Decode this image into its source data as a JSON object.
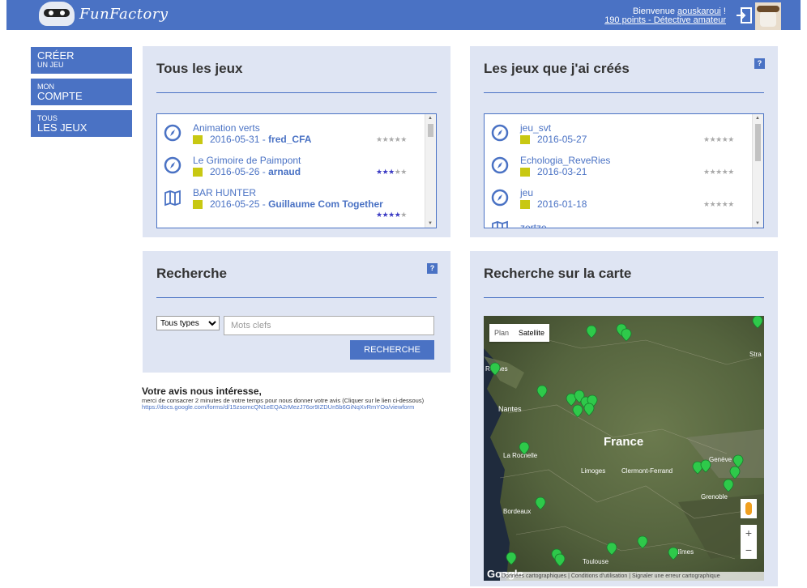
{
  "header": {
    "logo_text": "FunFactory",
    "welcome_prefix": "Bienvenue ",
    "username": "aouskaroui",
    "welcome_suffix": " !",
    "points": "190 points - Détective amateur"
  },
  "nav": [
    {
      "small": "Créer",
      "large": "un jeu"
    },
    {
      "small": "Mon",
      "large": "Compte"
    },
    {
      "small": "Tous",
      "large": "les jeux"
    }
  ],
  "all_games": {
    "title": "Tous les jeux",
    "items": [
      {
        "icon": "compass-icon",
        "title": "Animation verts",
        "date": "2016-05-31",
        "author": "fred_CFA",
        "rating": 0
      },
      {
        "icon": "compass-icon",
        "title": "Le Grimoire de Paimpont",
        "date": "2016-05-26",
        "author": "arnaud",
        "rating": 3
      },
      {
        "icon": "map-icon",
        "title": "BAR HUNTER",
        "date": "2016-05-25",
        "author": "Guillaume Com Together",
        "rating": 4
      }
    ]
  },
  "my_games": {
    "title": "Les jeux que j'ai créés",
    "help": "?",
    "items": [
      {
        "icon": "compass-icon",
        "title": "jeu_svt",
        "date": "2016-05-27",
        "rating": 0
      },
      {
        "icon": "compass-icon",
        "title": "Echologia_ReveRies",
        "date": "2016-03-21",
        "rating": 0
      },
      {
        "icon": "compass-icon",
        "title": "jeu",
        "date": "2016-01-18",
        "rating": 0
      },
      {
        "icon": "map-icon",
        "title": "zertze",
        "date": "",
        "rating": 0
      }
    ]
  },
  "search": {
    "title": "Recherche",
    "help": "?",
    "type_selected": "Tous types",
    "keywords_placeholder": "Mots clefs",
    "button": "RECHERCHE"
  },
  "feedback": {
    "heading": "Votre avis nous intéresse,",
    "text": "merci de consacrer 2 minutes de votre temps pour nous donner votre avis (Cliquer sur le lien ci-dessous)",
    "link": "https://docs.google.com/forms/d/15zsomcQN1eEQA2rMezJ76or9IZDUn5b6GiNqXvRmYOo/viewform"
  },
  "map_panel": {
    "title": "Recherche sur la carte",
    "toggle_plan": "Plan",
    "toggle_satellite": "Satellite",
    "zoom_in": "+",
    "zoom_out": "−",
    "google": "Google",
    "footer": "Données cartographiques | Conditions d'utilisation | Signaler une erreur cartographique",
    "labels": [
      "Rennes",
      "Nantes",
      "France",
      "La Rochelle",
      "Limoges",
      "Clermont-Ferrand",
      "Genève",
      "Grenoble",
      "Bordeaux",
      "Toulouse",
      "Nîmes",
      "Stra"
    ]
  },
  "colors": {
    "accent": "#4a72c4",
    "panel": "#dfe5f3",
    "tag": "#c8c812",
    "marker": "#2ec94a"
  }
}
